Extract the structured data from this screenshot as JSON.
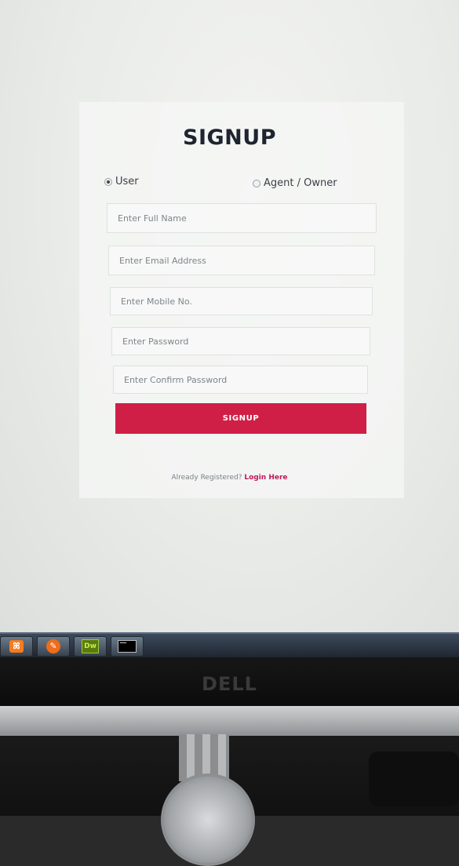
{
  "form": {
    "title": "SIGNUP",
    "role_options": [
      {
        "label": "User",
        "selected": true
      },
      {
        "label": "Agent / Owner",
        "selected": false
      }
    ],
    "fields": {
      "full_name_placeholder": "Enter Full Name",
      "email_placeholder": "Enter Email Address",
      "mobile_placeholder": "Enter Mobile No.",
      "password_placeholder": "Enter Password",
      "confirm_password_placeholder": "Enter Confirm Password"
    },
    "submit_label": "SIGNUP",
    "login_prompt": "Already Registered?",
    "login_link": "Login Here"
  },
  "taskbar": {
    "apps": [
      {
        "icon": "xampp-icon",
        "glyph": "ꕤ"
      },
      {
        "icon": "feather-icon",
        "glyph": "✎"
      },
      {
        "icon": "dreamweaver-icon",
        "glyph": "Dw"
      },
      {
        "icon": "command-prompt-icon",
        "glyph": ""
      }
    ]
  },
  "monitor": {
    "brand": "DELL"
  },
  "colors": {
    "accent": "#cf1f46",
    "link": "#c2185b",
    "title": "#1e2530"
  }
}
